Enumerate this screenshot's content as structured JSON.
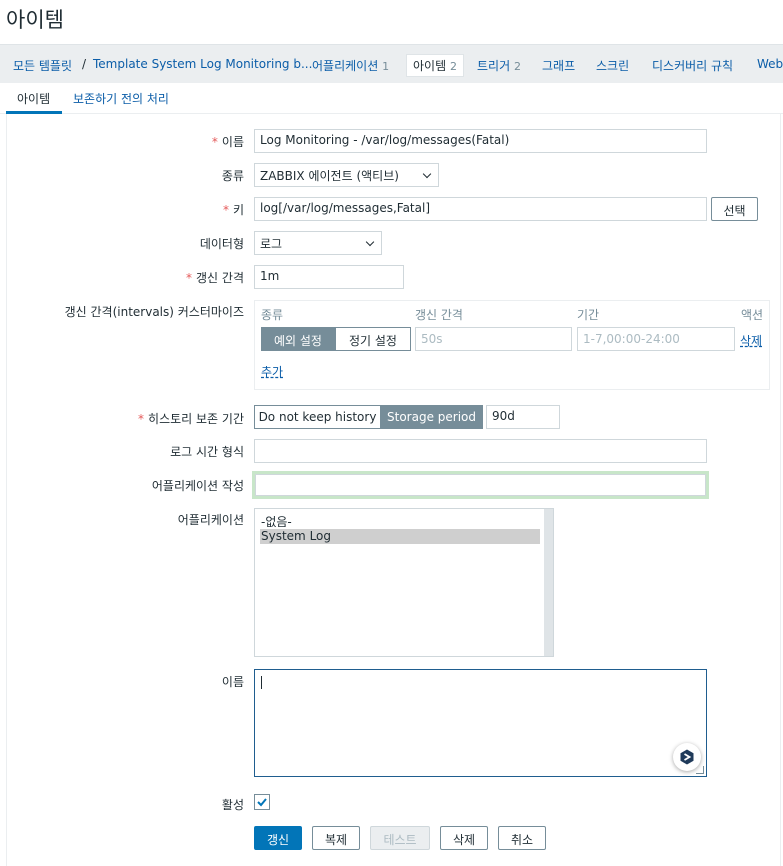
{
  "page": {
    "title": "아이템"
  },
  "breadcrumb": {
    "all_templates": "모든 템플릿",
    "separator": "/",
    "template": "Template System Log Monitoring b...",
    "applications": {
      "label": "어플리케이션",
      "count": "1"
    },
    "items": {
      "label": "아이템",
      "count": "2"
    },
    "triggers": {
      "label": "트리거",
      "count": "2"
    },
    "graphs": "그래프",
    "screens": "스크린",
    "discovery": "디스커버리 규칙",
    "web": "Web"
  },
  "tabs": {
    "item": "아이템",
    "preprocessing": "보존하기 전의 처리"
  },
  "form": {
    "name": {
      "label": "이름",
      "value": "Log Monitoring - /var/log/messages(Fatal)"
    },
    "type": {
      "label": "종류",
      "value": "ZABBIX 에이전트 (액티브)"
    },
    "key": {
      "label": "키",
      "value": "log[/var/log/messages,Fatal]",
      "select_button": "선택"
    },
    "data_type": {
      "label": "데이터형",
      "value": "로그"
    },
    "update_interval": {
      "label": "갱신 간격",
      "value": "1m"
    },
    "custom_intervals": {
      "label": "갱신 간격(intervals) 커스터마이즈",
      "headers": {
        "type": "종류",
        "interval": "갱신 간격",
        "period": "기간",
        "action": "액션"
      },
      "flexible": "예외 설정",
      "scheduling": "정기 설정",
      "interval_placeholder": "50s",
      "period_placeholder": "1-7,00:00-24:00",
      "remove": "삭제",
      "add": "추가"
    },
    "history": {
      "label": "히스토리 보존 기간",
      "no_keep": "Do not keep history",
      "storage_period": "Storage period",
      "value": "90d"
    },
    "log_time_format": {
      "label": "로그 시간 형식",
      "value": ""
    },
    "new_application": {
      "label": "어플리케이션 작성",
      "value": ""
    },
    "applications": {
      "label": "어플리케이션",
      "options": [
        "-없음-",
        "System Log"
      ],
      "selected": "System Log"
    },
    "description": {
      "label": "이름",
      "value": ""
    },
    "enabled": {
      "label": "활성",
      "checked": true
    }
  },
  "buttons": {
    "update": "갱신",
    "clone": "복제",
    "test": "테스트",
    "delete": "삭제",
    "cancel": "취소"
  },
  "colors": {
    "accent": "#0275b8",
    "link": "#0b5da8",
    "required": "#e45959",
    "new_app_border": "#c8e6c9"
  }
}
